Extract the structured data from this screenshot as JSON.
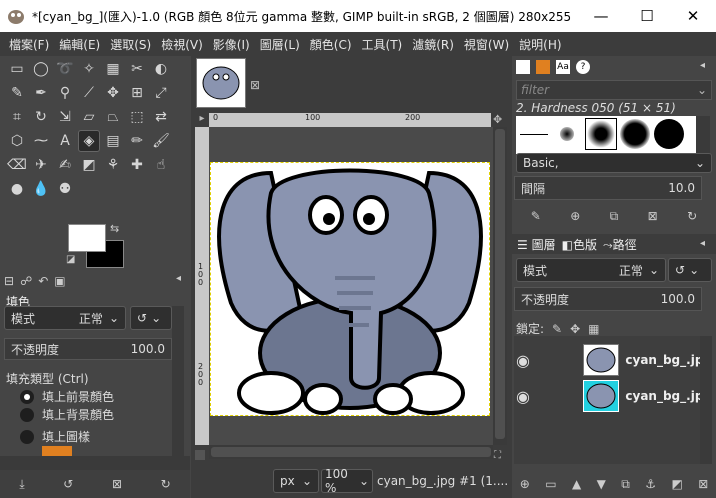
{
  "window": {
    "title": "*[cyan_bg_](匯入)-1.0 (RGB 顏色 8位元 gamma 整數, GIMP built-in sRGB, 2 個圖層) 280x255 – ...",
    "minimize": "—",
    "maximize": "☐",
    "close": "✕"
  },
  "menu": [
    "檔案(F)",
    "編輯(E)",
    "選取(S)",
    "檢視(V)",
    "影像(I)",
    "圖層(L)",
    "顏色(C)",
    "工具(T)",
    "濾鏡(R)",
    "視窗(W)",
    "說明(H)"
  ],
  "tool_options": {
    "title": "填色",
    "mode_label": "模式",
    "mode_value": "正常",
    "opacity_label": "不透明度",
    "opacity_value": "100.0",
    "fill_type_label": "填充類型 (Ctrl)",
    "fill_options": [
      "填上前景顏色",
      "填上背景顏色",
      "填上圖樣"
    ]
  },
  "canvas": {
    "unit": "px",
    "zoom": "100 %",
    "status": "cyan_bg_.jpg #1 (1....",
    "ruler_h": [
      "0",
      "100",
      "200"
    ],
    "ruler_v": [
      "1",
      "0",
      "0",
      "2",
      "0",
      "0"
    ]
  },
  "brushes": {
    "filter_placeholder": "filter",
    "current_brush": "2. Hardness 050 (51 × 51)",
    "preset": "Basic,",
    "spacing_label": "間隔",
    "spacing_value": "10.0"
  },
  "layers_panel": {
    "tabs": [
      "圖層",
      "色版",
      "路徑"
    ],
    "mode_label": "模式",
    "mode_value": "正常",
    "opacity_label": "不透明度",
    "opacity_value": "100.0",
    "lock_label": "鎖定:",
    "layers": [
      {
        "name": "cyan_bg_.jpg"
      },
      {
        "name": "cyan_bg_.jpg"
      }
    ]
  },
  "colors": {
    "accent_cyan": "#22d0e0",
    "elephant": "#8a94b0",
    "elephant_dark": "#6c7690"
  }
}
